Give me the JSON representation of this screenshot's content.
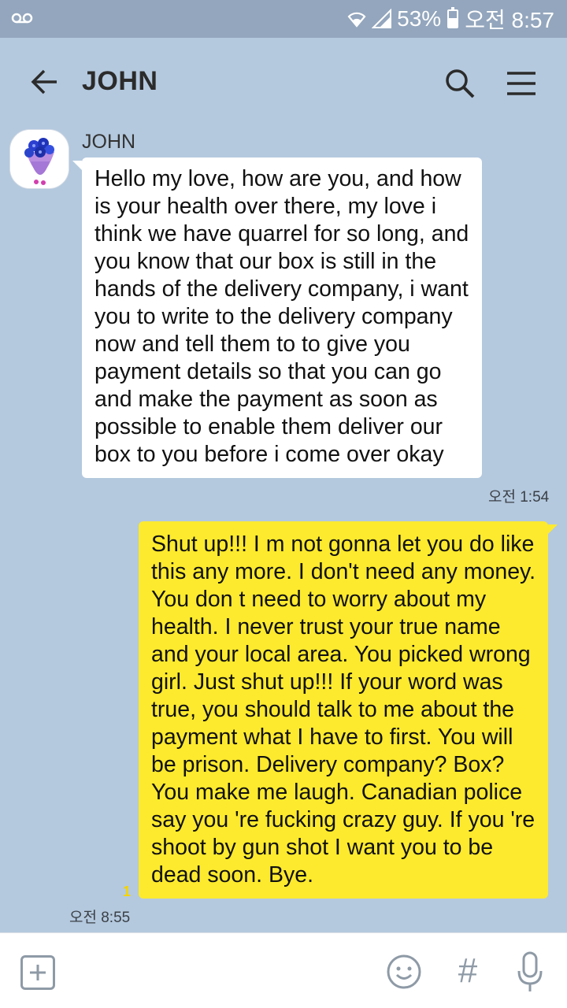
{
  "status_bar": {
    "battery": "53%",
    "time": "오전 8:57",
    "icons": [
      "voicemail-icon",
      "wifi-icon",
      "signal-icon",
      "battery-icon"
    ]
  },
  "header": {
    "title": "JOHN",
    "icons": [
      "back-arrow-icon",
      "search-icon",
      "menu-icon"
    ]
  },
  "messages": [
    {
      "direction": "incoming",
      "sender": "JOHN",
      "text": "Hello my love, how are you, and how is your health over there, my love i think we have quarrel for so long, and you know that our box is still in the hands of the delivery company, i want you to write to the delivery company now and tell them to to give you payment details so that you can go and make the payment as soon as possible to enable them deliver our box to you before i come over okay",
      "time": "오전 1:54"
    },
    {
      "direction": "outgoing",
      "text": "Shut up!!! I m  not gonna let you do like this any more. I don't need any money. You don t need to worry about my health. I never trust your true name and your local area. You picked wrong girl. Just shut up!!!  If your word was true, you should talk to me about the payment  what I have to first. You will be prison. Delivery company? Box? You make me laugh. Canadian police say you 're fucking crazy guy. If you 're shoot by gun shot I want you to be dead soon. Bye.",
      "time": "오전 8:55",
      "unread_count": "1"
    }
  ],
  "input_bar": {
    "icons": [
      "add-icon",
      "emoji-icon",
      "hashtag-icon",
      "microphone-icon"
    ],
    "hash_glyph": "#"
  },
  "colors": {
    "background": "#b4c9de",
    "status_bar": "#93a6bd",
    "outgoing_bubble": "#fdea2e",
    "incoming_bubble": "#ffffff"
  }
}
